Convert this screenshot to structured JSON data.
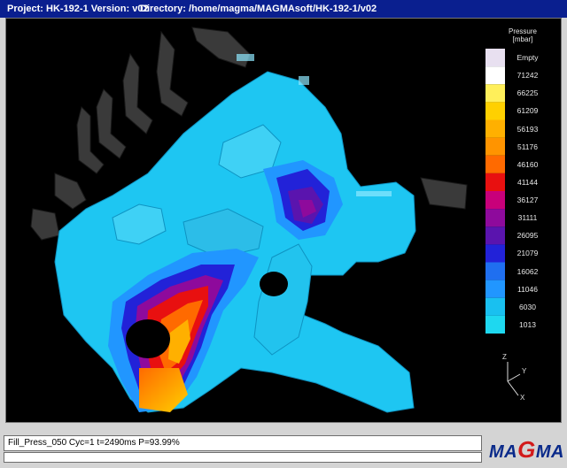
{
  "window": {
    "project": "Project: HK-192-1 Version: v02",
    "directory": "Directory: /home/magma/MAGMAsoft/HK-192-1/v02"
  },
  "legend": {
    "title_line1": "Pressure",
    "title_line2": "[mbar]",
    "entries": [
      "Empty",
      "71242",
      "66225",
      "61209",
      "56193",
      "51176",
      "46160",
      "41144",
      "36127",
      "31111",
      "26095",
      "21079",
      "16062",
      "11046",
      "6030",
      "1013"
    ],
    "colors": [
      "#e8e0f0",
      "#ffffff",
      "#ffef5a",
      "#ffd000",
      "#ffb000",
      "#ff9400",
      "#ff6a00",
      "#e81010",
      "#c8007a",
      "#8e0a9c",
      "#5a14ae",
      "#2222d8",
      "#1f6ff0",
      "#2196ff",
      "#19c0f0",
      "#1ed8f0"
    ]
  },
  "axes": {
    "z": "Z",
    "y": "Y",
    "x": "X"
  },
  "status": {
    "line1": "Fill_Press_050 Cyc=1 t=2490ms P=93.99%"
  },
  "logo": {
    "text_pre": "MA",
    "text_g": "G",
    "text_post": "MA"
  }
}
